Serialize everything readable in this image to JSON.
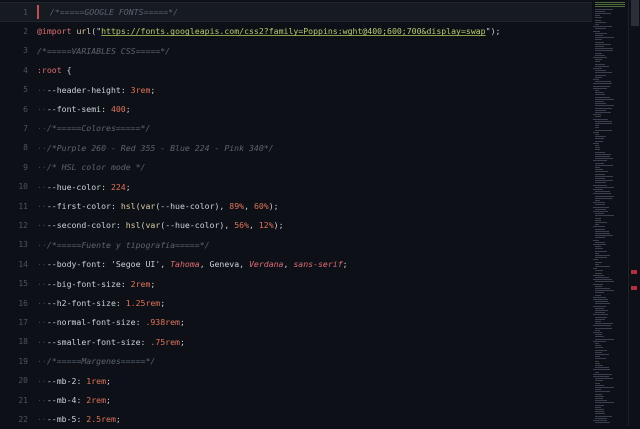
{
  "editor": {
    "lines": [
      {
        "num": "1",
        "tokens": [
          {
            "t": "ws",
            "v": "  "
          },
          {
            "t": "cm",
            "v": "/*=====GOOGLE FONTS=====*/"
          }
        ]
      },
      {
        "num": "2",
        "tokens": [
          {
            "t": "kw",
            "v": "@import"
          },
          {
            "t": "pc",
            "v": " "
          },
          {
            "t": "fn",
            "v": "url"
          },
          {
            "t": "pc",
            "v": "("
          },
          {
            "t": "qs",
            "v": "\""
          },
          {
            "t": "str",
            "v": "https://fonts.googleapis.com/css2?family=Poppins:wght@400;600;700&display=swap"
          },
          {
            "t": "qs",
            "v": "\""
          },
          {
            "t": "pc",
            "v": ");"
          }
        ]
      },
      {
        "num": "3",
        "tokens": [
          {
            "t": "cm",
            "v": "/*=====VARIABLES CSS=====*/"
          }
        ]
      },
      {
        "num": "4",
        "tokens": [
          {
            "t": "kw",
            "v": ":root"
          },
          {
            "t": "pc",
            "v": " {"
          }
        ]
      },
      {
        "num": "5",
        "tokens": [
          {
            "t": "ws",
            "v": "··"
          },
          {
            "t": "prop",
            "v": "--header-height"
          },
          {
            "t": "pc",
            "v": ": "
          },
          {
            "t": "num",
            "v": "3rem"
          },
          {
            "t": "pc",
            "v": ";"
          }
        ]
      },
      {
        "num": "6",
        "tokens": [
          {
            "t": "ws",
            "v": "··"
          },
          {
            "t": "prop",
            "v": "--font-semi"
          },
          {
            "t": "pc",
            "v": ": "
          },
          {
            "t": "num",
            "v": "400"
          },
          {
            "t": "pc",
            "v": ";"
          }
        ]
      },
      {
        "num": "7",
        "tokens": [
          {
            "t": "ws",
            "v": "··"
          },
          {
            "t": "cm",
            "v": "/*=====Colores=====*/"
          }
        ]
      },
      {
        "num": "8",
        "tokens": [
          {
            "t": "ws",
            "v": "··"
          },
          {
            "t": "cm",
            "v": "/*Purple 260 - Red 355 - Blue 224 - Pink 340*/"
          }
        ]
      },
      {
        "num": "9",
        "tokens": [
          {
            "t": "ws",
            "v": "··"
          },
          {
            "t": "cm",
            "v": "/* HSL color mode */"
          }
        ]
      },
      {
        "num": "10",
        "tokens": [
          {
            "t": "ws",
            "v": "··"
          },
          {
            "t": "prop",
            "v": "--hue-color"
          },
          {
            "t": "pc",
            "v": ": "
          },
          {
            "t": "num",
            "v": "224"
          },
          {
            "t": "pc",
            "v": ";"
          }
        ]
      },
      {
        "num": "11",
        "tokens": [
          {
            "t": "ws",
            "v": "··"
          },
          {
            "t": "prop",
            "v": "--first-color"
          },
          {
            "t": "pc",
            "v": ": "
          },
          {
            "t": "fn",
            "v": "hsl"
          },
          {
            "t": "pc",
            "v": "("
          },
          {
            "t": "fn",
            "v": "var"
          },
          {
            "t": "pc",
            "v": "(--hue-color), "
          },
          {
            "t": "num",
            "v": "89%"
          },
          {
            "t": "pc",
            "v": ", "
          },
          {
            "t": "num",
            "v": "60%"
          },
          {
            "t": "pc",
            "v": ");"
          }
        ]
      },
      {
        "num": "12",
        "tokens": [
          {
            "t": "ws",
            "v": "··"
          },
          {
            "t": "prop",
            "v": "--second-color"
          },
          {
            "t": "pc",
            "v": ": "
          },
          {
            "t": "fn",
            "v": "hsl"
          },
          {
            "t": "pc",
            "v": "("
          },
          {
            "t": "fn",
            "v": "var"
          },
          {
            "t": "pc",
            "v": "(--hue-color), "
          },
          {
            "t": "num",
            "v": "56%"
          },
          {
            "t": "pc",
            "v": ", "
          },
          {
            "t": "num",
            "v": "12%"
          },
          {
            "t": "pc",
            "v": ");"
          }
        ]
      },
      {
        "num": "13",
        "tokens": [
          {
            "t": "ws",
            "v": "··"
          },
          {
            "t": "cm",
            "v": "/*=====Fuente y tipografia=====*/"
          }
        ]
      },
      {
        "num": "14",
        "tokens": [
          {
            "t": "ws",
            "v": "··"
          },
          {
            "t": "prop",
            "v": "--body-font"
          },
          {
            "t": "pc",
            "v": ": "
          },
          {
            "t": "sel",
            "v": "'Segoe UI'"
          },
          {
            "t": "pc",
            "v": ", "
          },
          {
            "t": "it",
            "v": "Tahoma"
          },
          {
            "t": "pc",
            "v": ", Geneva, "
          },
          {
            "t": "it",
            "v": "Verdana"
          },
          {
            "t": "pc",
            "v": ", "
          },
          {
            "t": "it",
            "v": "sans-serif"
          },
          {
            "t": "pc",
            "v": ";"
          }
        ]
      },
      {
        "num": "15",
        "tokens": [
          {
            "t": "ws",
            "v": "··"
          },
          {
            "t": "prop",
            "v": "--big-font-size"
          },
          {
            "t": "pc",
            "v": ": "
          },
          {
            "t": "num",
            "v": "2rem"
          },
          {
            "t": "pc",
            "v": ";"
          }
        ]
      },
      {
        "num": "16",
        "tokens": [
          {
            "t": "ws",
            "v": "··"
          },
          {
            "t": "prop",
            "v": "--h2-font-size"
          },
          {
            "t": "pc",
            "v": ": "
          },
          {
            "t": "num",
            "v": "1.25rem"
          },
          {
            "t": "pc",
            "v": ";"
          }
        ]
      },
      {
        "num": "17",
        "tokens": [
          {
            "t": "ws",
            "v": "··"
          },
          {
            "t": "prop",
            "v": "--normal-font-size"
          },
          {
            "t": "pc",
            "v": ": "
          },
          {
            "t": "num",
            "v": ".938rem"
          },
          {
            "t": "pc",
            "v": ";"
          }
        ]
      },
      {
        "num": "18",
        "tokens": [
          {
            "t": "ws",
            "v": "··"
          },
          {
            "t": "prop",
            "v": "--smaller-font-size"
          },
          {
            "t": "pc",
            "v": ": "
          },
          {
            "t": "num",
            "v": ".75rem"
          },
          {
            "t": "pc",
            "v": ";"
          }
        ]
      },
      {
        "num": "19",
        "tokens": [
          {
            "t": "ws",
            "v": "··"
          },
          {
            "t": "cm",
            "v": "/*=====Margenes=====*/"
          }
        ]
      },
      {
        "num": "20",
        "tokens": [
          {
            "t": "ws",
            "v": "··"
          },
          {
            "t": "prop",
            "v": "--mb-2"
          },
          {
            "t": "pc",
            "v": ": "
          },
          {
            "t": "num",
            "v": "1rem"
          },
          {
            "t": "pc",
            "v": ";"
          }
        ]
      },
      {
        "num": "21",
        "tokens": [
          {
            "t": "ws",
            "v": "··"
          },
          {
            "t": "prop",
            "v": "--mb-4"
          },
          {
            "t": "pc",
            "v": ": "
          },
          {
            "t": "num",
            "v": "2rem"
          },
          {
            "t": "pc",
            "v": ";"
          }
        ]
      },
      {
        "num": "22",
        "tokens": [
          {
            "t": "ws",
            "v": "··"
          },
          {
            "t": "prop",
            "v": "--mb-5"
          },
          {
            "t": "pc",
            "v": ": "
          },
          {
            "t": "num",
            "v": "2.5rem"
          },
          {
            "t": "pc",
            "v": ";"
          }
        ]
      }
    ],
    "active_line": "1"
  },
  "colors": {
    "background": "#0d1117",
    "comment": "#5c6370",
    "keyword": "#e06c75",
    "number": "#e0725a",
    "string": "#b5cc6e",
    "cursor": "#c64a55"
  }
}
